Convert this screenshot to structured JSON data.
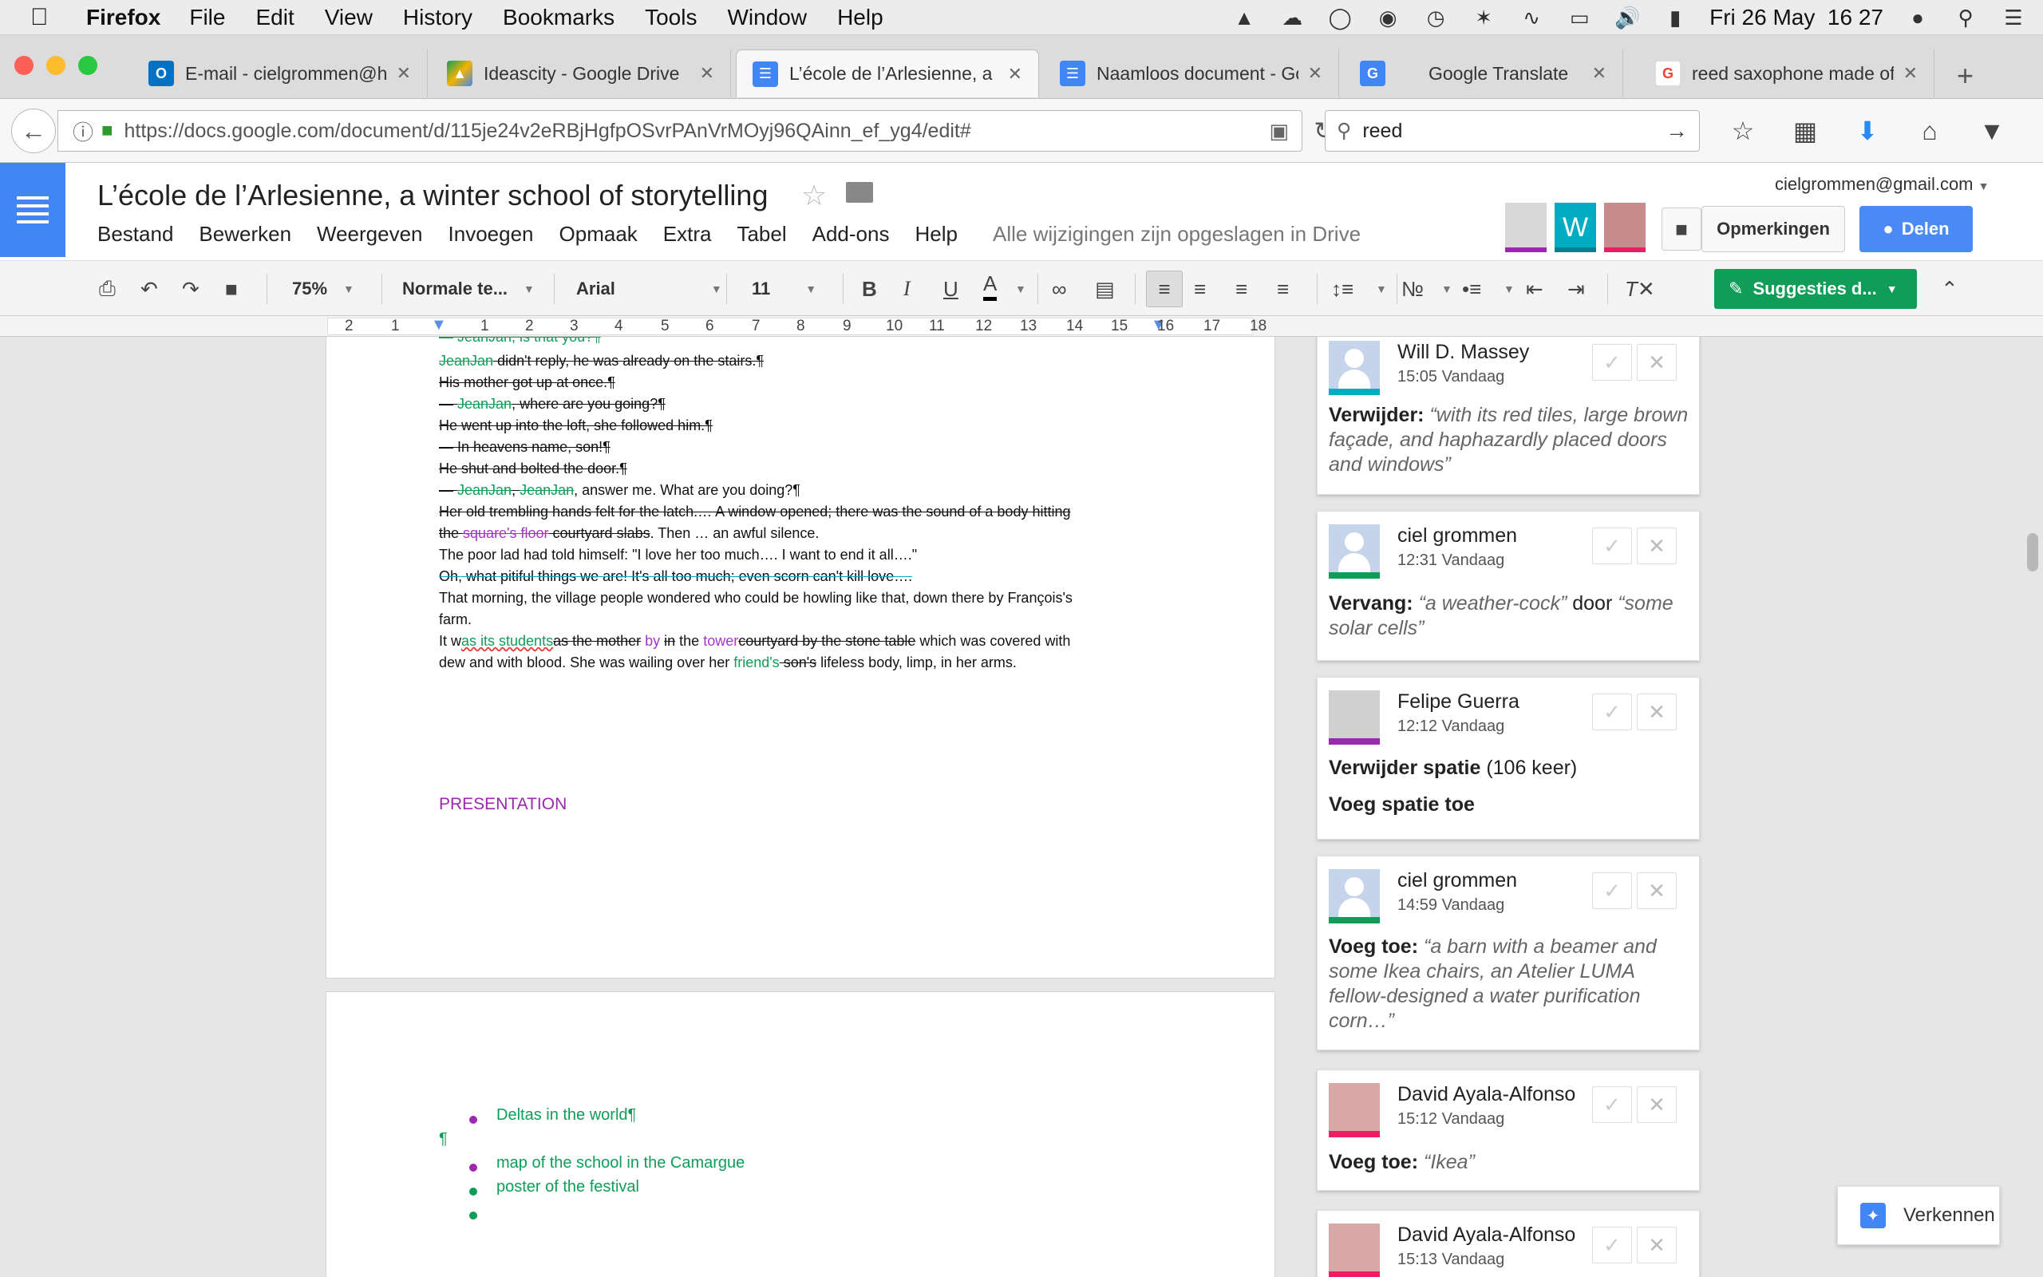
{
  "mac_menubar": {
    "app_name": "Firefox",
    "items": [
      "File",
      "Edit",
      "View",
      "History",
      "Bookmarks",
      "Tools",
      "Window",
      "Help"
    ],
    "clock": "Fri 26 May  16 27"
  },
  "tabs": [
    {
      "title": "E-mail - cielgrommen@h",
      "icon": "outlook-icon",
      "color": "#0072c6"
    },
    {
      "title": "Ideascity - Google Drive",
      "icon": "google-drive-icon",
      "color": "#f4b400"
    },
    {
      "title": "L’école de l’Arlesienne, a",
      "icon": "google-docs-icon",
      "color": "#4285f4"
    },
    {
      "title": "Naamloos document - Go",
      "icon": "google-docs-icon",
      "color": "#4285f4"
    },
    {
      "title": "Google Translate",
      "icon": "google-translate-icon",
      "color": "#4285f4"
    },
    {
      "title": "reed saxophone made of",
      "icon": "google-icon",
      "color": "#ea4335"
    }
  ],
  "navbar": {
    "url": "https://docs.google.com/document/d/115je24v2eRBjHgfpOSvrPAnVrMOyj96QAinn_ef_yg4/edit#",
    "search_value": "reed"
  },
  "doc": {
    "title": "L’école de l’Arlesienne, a winter school of storytelling",
    "menu": [
      "Bestand",
      "Bewerken",
      "Weergeven",
      "Invoegen",
      "Opmaak",
      "Extra",
      "Tabel",
      "Add-ons",
      "Help"
    ],
    "saved_status": "Alle wijzigingen zijn opgeslagen in Drive",
    "account": "cielgrommen@gmail.com",
    "comments_btn": "Opmerkingen",
    "share_btn": "Delen",
    "avatar_letter": "W"
  },
  "toolbar": {
    "zoom": "75%",
    "style": "Normale te...",
    "font": "Arial",
    "size": "11",
    "bold": "B",
    "italic": "I",
    "underline": "U",
    "textcolor": "A",
    "suggest_mode": "Suggesties d..."
  },
  "ruler": [
    "2",
    "1",
    "1",
    "2",
    "3",
    "4",
    "5",
    "6",
    "7",
    "8",
    "9",
    "10",
    "11",
    "12",
    "13",
    "14",
    "15",
    "16",
    "17",
    "18"
  ],
  "content": {
    "l0a": "— JeanJan, is that you?¶",
    "l1a": "JeanJan",
    "l1b": " didn't reply, he was already on the stairs.¶",
    "l2": "His mother got up at once.¶",
    "l3a": "— ",
    "l3b": "JeanJan",
    "l3c": ", where are you going?¶",
    "l4": "He went up into the loft, she followed him.¶",
    "l5": "— In heavens name, son!¶",
    "l6": "He shut and bolted the door.¶",
    "l7a": "— ",
    "l7b": "JeanJan",
    "l7c": ", ",
    "l7d": "JeanJan",
    "l7e": ", answer me. What are you doing?¶",
    "l8": "Her old trembling hands felt for the latch.… A window opened; there was the sound of a body hitting",
    "l9a": "the ",
    "l9b": "square's floor",
    "l9c": " courtyard slabs",
    "l9d": ". Then … an awful silence.",
    "l10": "The poor lad had told himself: \"I love her too much…. I want to end it all….\"",
    "l11": "Oh, what pitiful things we are! It's all too much; even scorn can't kill love….",
    "l12": "That morning, the village people wondered who could be howling like that, down there by François's",
    "l13": "farm.",
    "l14a": "It w",
    "l14b": "as its students",
    "l14c": "as the mother",
    "l14d": " by ",
    "l14e": "in",
    "l14f": " the ",
    "l14g": "tower",
    "l14h": "courtyard by the stone table",
    "l14i": " which was covered with",
    "l15a": "dew and with blood. She was wailing over her ",
    "l15b": "friend's",
    "l15c": " son's",
    "l15d": " lifeless body, limp, in her arms.",
    "presentation": "PRESENTATION",
    "pilcrow": "¶",
    "bullets": [
      "Deltas in the world¶",
      "map of the school in the Camargue",
      "poster of the festival",
      ""
    ]
  },
  "comments": [
    {
      "name": "Will D. Massey",
      "time": "15:05 Vandaag",
      "action": "Verwijder:",
      "quote": "“with its red tiles, large brown façade, and haphazardly placed doors and windows”",
      "color": "#00acc1"
    },
    {
      "name": "ciel grommen",
      "time": "12:31 Vandaag",
      "action": "Vervang:",
      "quote": "“a weather-cock”",
      "mid": " door ",
      "quote2": "“some solar cells”",
      "color": "#0f9d58"
    },
    {
      "name": "Felipe Guerra",
      "time": "12:12 Vandaag",
      "action": "Verwijder spatie",
      "count": " (106 keer)",
      "action2": "Voeg spatie toe",
      "color": "#9c27b0"
    },
    {
      "name": "ciel grommen",
      "time": "14:59 Vandaag",
      "action": "Voeg toe:",
      "quote": "“a barn with a beamer and some Ikea chairs, an Atelier LUMA fellow-designed a water purification corn…”",
      "color": "#0f9d58"
    },
    {
      "name": "David Ayala-Alfonso",
      "time": "15:12 Vandaag",
      "action": "Voeg toe:",
      "quote": "“Ikea”",
      "color": "#e91e63"
    },
    {
      "name": "David Ayala-Alfonso",
      "time": "15:13 Vandaag",
      "color": "#e91e63"
    }
  ],
  "explore": "Verkennen"
}
